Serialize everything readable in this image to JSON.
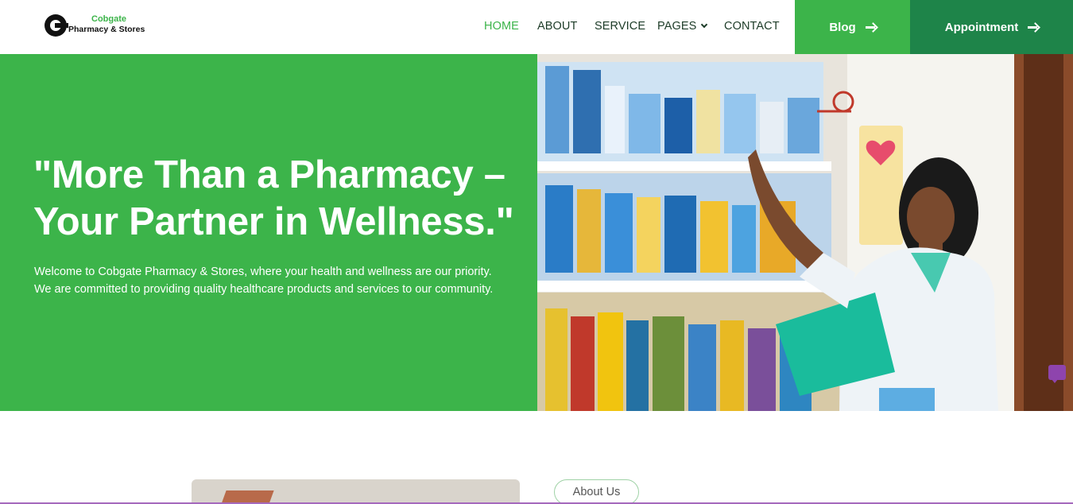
{
  "brand": {
    "name_line1": "Cobgate",
    "name_line2": "Pharmacy & Stores"
  },
  "nav": {
    "items": [
      {
        "label": "HOME",
        "active": true
      },
      {
        "label": "ABOUT",
        "active": false
      },
      {
        "label": "SERVICE",
        "active": false
      },
      {
        "label": "PAGES",
        "active": false,
        "has_dropdown": true
      },
      {
        "label": "CONTACT",
        "active": false
      }
    ],
    "blog_label": "Blog",
    "appointment_label": "Appointment"
  },
  "hero": {
    "title_line1": "\"More Than a Pharmacy –",
    "title_line2": "Your Partner in Wellness.\"",
    "description": "Welcome to Cobgate Pharmacy & Stores, where your health and wellness are our priority. We are committed to providing quality healthcare products and services to our community."
  },
  "about": {
    "pill_label": "About Us"
  },
  "colors": {
    "primary_green": "#3cb44a",
    "dark_green": "#1e8449",
    "nav_text": "#1c3b27",
    "chat_purple": "#8e44ad"
  },
  "icons": {
    "blog_arrow": "arrow-right-icon",
    "appointment_arrow": "arrow-right-icon",
    "pages_dropdown": "chevron-down-icon",
    "chat": "chat-icon"
  }
}
